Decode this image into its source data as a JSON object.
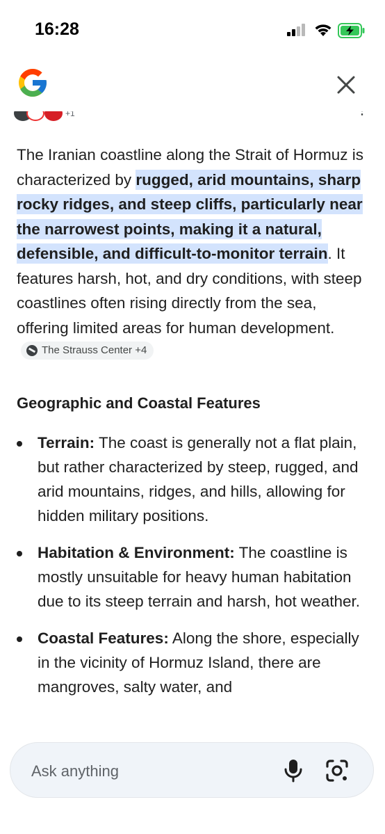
{
  "status_bar": {
    "time": "16:28"
  },
  "header": {
    "logo": "google-g-logo",
    "close_icon": "close-icon"
  },
  "sources_strip": {
    "more": "+1"
  },
  "answer": {
    "intro_before": "The Iranian coastline along the Strait of Hormuz is characterized by ",
    "intro_highlight": "rugged, arid mountains, sharp rocky ridges, and steep cliffs, particularly near the narrowest points, making it a natural, defensible, and difficult-to-monitor terrain",
    "intro_after": ". It features harsh, hot, and dry conditions, with steep coastlines often rising directly from the sea, offering limited areas for human development.",
    "source_chip": "The Strauss Center +4",
    "section_heading": "Geographic and Coastal Features",
    "bullets": [
      {
        "label": "Terrain:",
        "text": " The coast is generally not a flat plain, but rather characterized by steep, rugged, and arid mountains, ridges, and hills, allowing for hidden military positions."
      },
      {
        "label": "Habitation & Environment:",
        "text": " The coastline is mostly unsuitable for heavy human habitation due to its steep terrain and harsh, hot weather."
      },
      {
        "label": "Coastal Features:",
        "text": " Along the shore, especially in the vicinity of Hormuz Island, there are mangroves, salty water, and"
      }
    ]
  },
  "ask_bar": {
    "placeholder": "Ask anything",
    "mic_icon": "microphone-icon",
    "lens_icon": "lens-camera-icon"
  },
  "colors": {
    "highlight": "#d3e3fd",
    "ask_bar_bg": "#f0f4f9",
    "battery_green": "#34c759"
  }
}
